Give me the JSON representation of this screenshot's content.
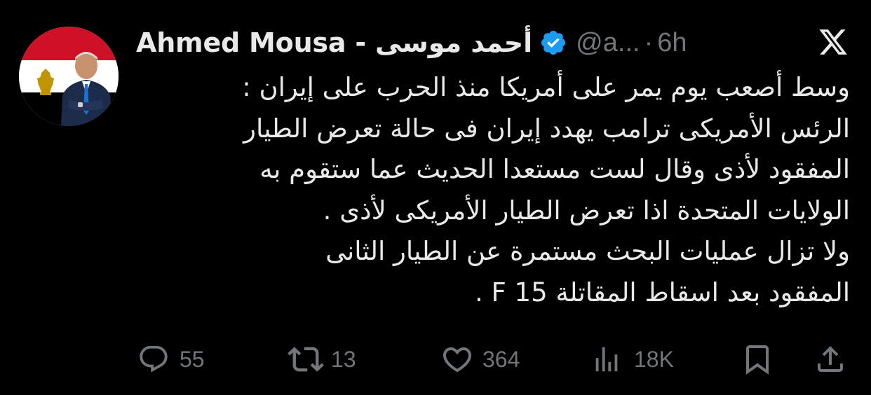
{
  "author": {
    "display_name": "Ahmed Mousa - أحمد موسى",
    "handle": "@a...",
    "separator": "·",
    "time": "6h",
    "verified": true,
    "avatar": "profile-photo-egypt-flag"
  },
  "tweet": {
    "lines": [
      "وسط أصعب يوم يمر على أمريكا منذ الحرب على إيران :",
      "الرئس الأمريكى ترامب يهدد إيران فى حالة تعرض الطيار",
      "المفقود لأذى وقال لست مستعدا الحديث عما ستقوم به",
      "الولايات المتحدة اذا تعرض الطيار الأمريكى لأذى .",
      "ولا تزال عمليات البحث مستمرة عن الطيار الثانى",
      "المفقود بعد اسقاط المقاتلة F 15 ."
    ]
  },
  "actions": {
    "replies": "55",
    "reposts": "13",
    "likes": "364",
    "views": "18K"
  },
  "icons": {
    "reply": "reply-icon",
    "repost": "repost-icon",
    "like": "heart-icon",
    "views": "views-icon",
    "bookmark": "bookmark-icon",
    "share": "share-icon",
    "brand": "x-logo-icon",
    "verified": "verified-badge-icon"
  },
  "colors": {
    "background": "#000000",
    "text": "#e7e9ea",
    "muted": "#71767b",
    "verified": "#1d9bf0"
  }
}
